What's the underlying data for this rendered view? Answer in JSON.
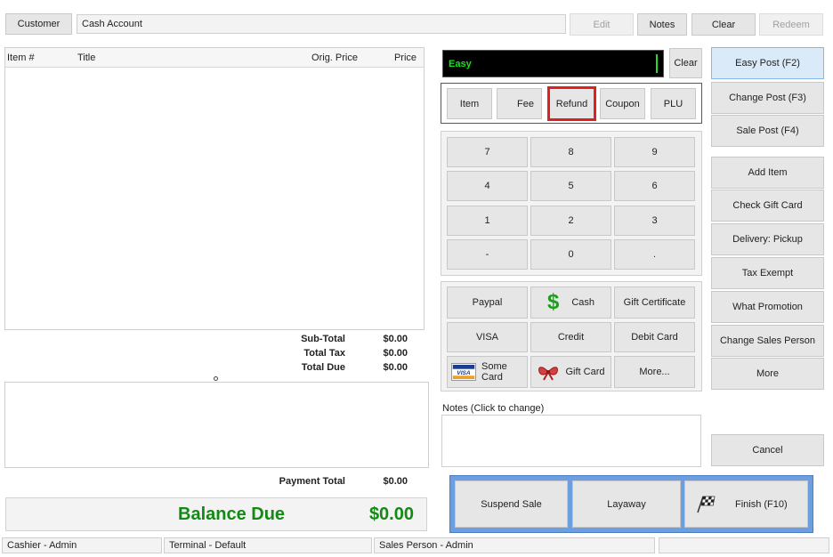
{
  "topbar": {
    "customer_label": "Customer",
    "customer_value": "Cash Account",
    "edit_label": "Edit",
    "notes_label": "Notes",
    "clear_label": "Clear",
    "redeem_label": "Redeem"
  },
  "table": {
    "headers": [
      "Item #",
      "Title",
      "Orig. Price",
      "Price"
    ]
  },
  "totals": {
    "subtotal_label": "Sub-Total",
    "subtotal_value": "$0.00",
    "tax_label": "Total Tax",
    "tax_value": "$0.00",
    "due_label": "Total Due",
    "due_value": "$0.00",
    "payment_label": "Payment Total",
    "payment_value": "$0.00",
    "balance_label": "Balance Due",
    "balance_value": "$0.00",
    "balance_color": "#138a13"
  },
  "entry": {
    "mode_text": "Easy",
    "clear_label": "Clear"
  },
  "types": {
    "item": "Item",
    "fee": "Fee",
    "refund": "Refund",
    "coupon": "Coupon",
    "plu": "PLU",
    "highlight_color": "#e02020"
  },
  "keypad": {
    "k7": "7",
    "k8": "8",
    "k9": "9",
    "k4": "4",
    "k5": "5",
    "k6": "6",
    "k1": "1",
    "k2": "2",
    "k3": "3",
    "kminus": "-",
    "k0": "0",
    "kdot": "."
  },
  "payments": {
    "paypal": "Paypal",
    "cash": "Cash",
    "gift_cert": "Gift Certificate",
    "visa": "VISA",
    "credit": "Credit",
    "debit": "Debit Card",
    "some_card": "Some Card",
    "gift_card": "Gift Card",
    "more": "More..."
  },
  "notes": {
    "label": "Notes (Click to change)"
  },
  "sidebar": {
    "easy_post": "Easy Post (F2)",
    "change_post": "Change Post (F3)",
    "sale_post": "Sale Post (F4)",
    "add_item": "Add Item",
    "check_gift": "Check Gift Card",
    "delivery": "Delivery: Pickup",
    "tax_exempt": "Tax Exempt",
    "what_promo": "What Promotion",
    "change_salesperson": "Change Sales Person",
    "more": "More",
    "cancel": "Cancel"
  },
  "actions": {
    "suspend": "Suspend Sale",
    "layaway": "Layaway",
    "finish": "Finish (F10)"
  },
  "status": {
    "cashier": "Cashier - Admin",
    "terminal": "Terminal - Default",
    "salesperson": "Sales Person - Admin"
  },
  "icons": {
    "cash": "dollar-icon",
    "some_card": "visa-card-icon",
    "gift_card": "gift-ribbon-icon",
    "finish": "checkered-flag-icon"
  }
}
